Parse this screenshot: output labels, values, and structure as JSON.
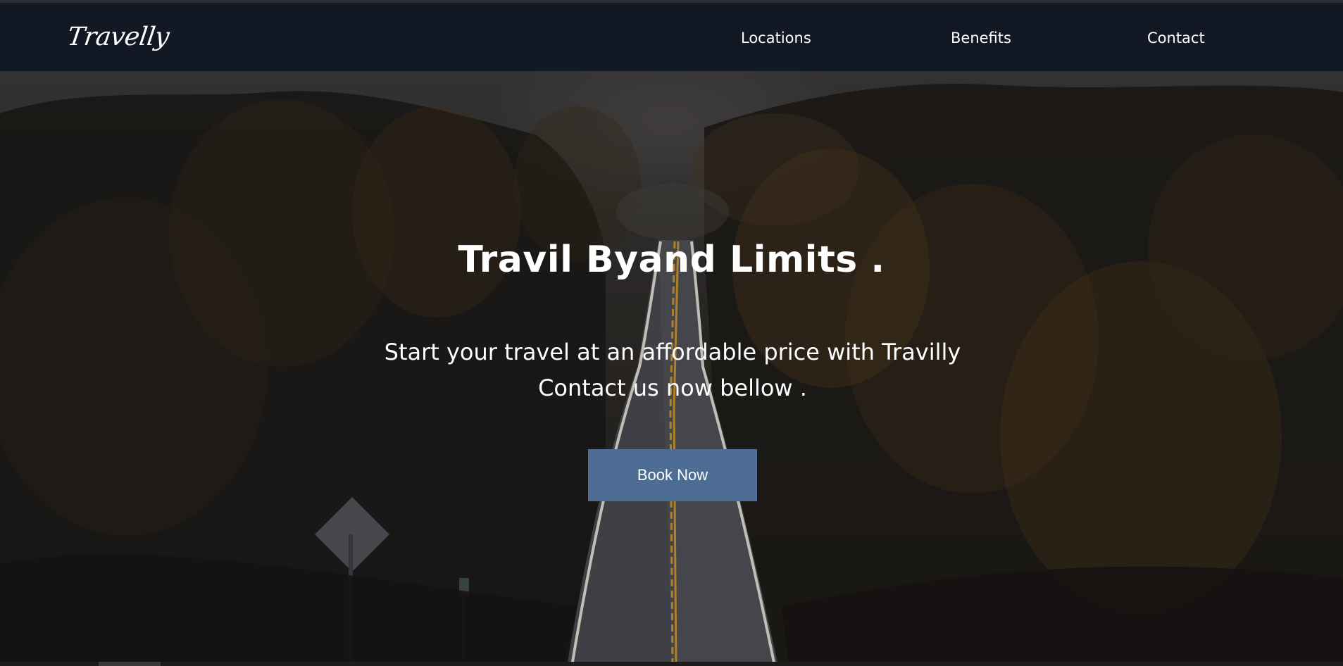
{
  "brand": {
    "name": "Travelly"
  },
  "nav": {
    "links": [
      {
        "label": "Locations"
      },
      {
        "label": "Benefits"
      },
      {
        "label": "Contact"
      }
    ]
  },
  "hero": {
    "title": "Travil Byand Limits .",
    "subtitle_lines": [
      "Start your travel at an affordable price with Travilly",
      "Contact us now bellow ."
    ],
    "cta_label": "Book Now"
  },
  "colors": {
    "navbar_bg": "#131924",
    "cta_bg": "#4e6d95",
    "text": "#ffffff"
  }
}
